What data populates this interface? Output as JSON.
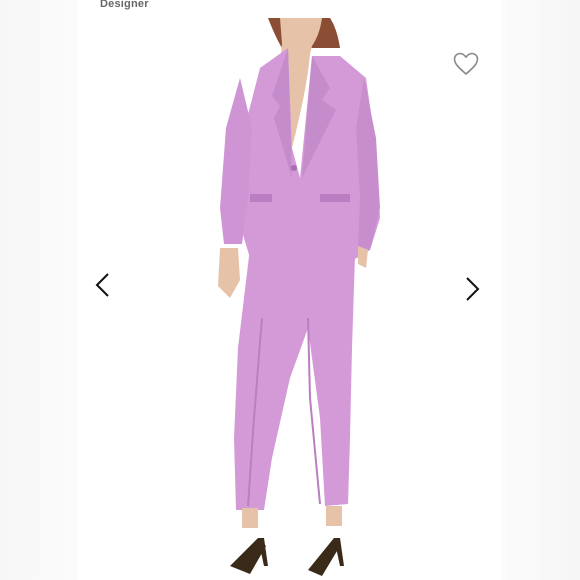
{
  "listing": {
    "brand_tag": "Designer"
  },
  "icons": {
    "favorite": "heart-outline-icon",
    "previous": "chevron-left-icon",
    "next": "chevron-right-icon"
  },
  "colors": {
    "suit": "#d49ad8",
    "suit_shadow": "#bb7ec2",
    "skin": "#e6c2a9",
    "hair": "#8b4d33",
    "sandal": "#3a2a1a",
    "icon_gray": "#8a8a8a"
  }
}
